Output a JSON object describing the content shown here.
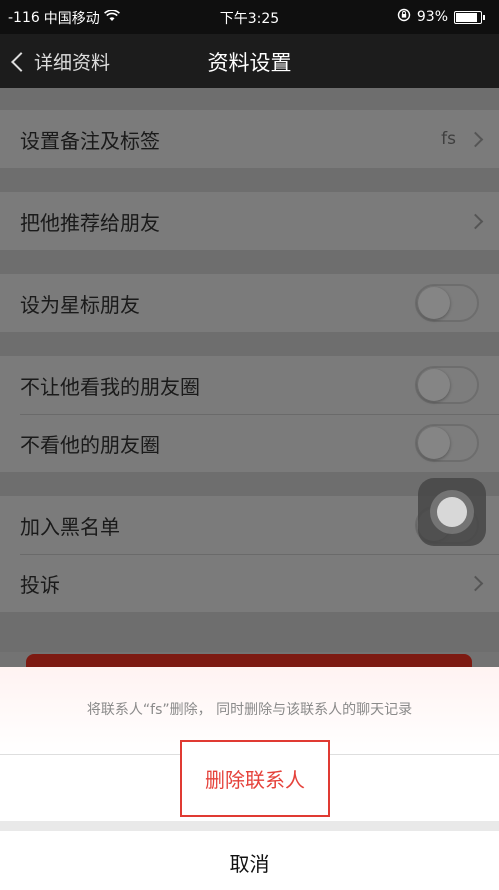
{
  "status_bar": {
    "signal": "-116",
    "carrier": "中国移动",
    "wifi_icon": "wifi-icon",
    "time": "下午3:25",
    "lock_icon": "rotation-lock-icon",
    "battery_percent": "93%",
    "battery_level": 0.93
  },
  "nav": {
    "back_label": "详细资料",
    "title": "资料设置"
  },
  "rows": {
    "remark": {
      "label": "设置备注及标签",
      "value": "fs"
    },
    "recommend": {
      "label": "把他推荐给朋友"
    },
    "star": {
      "label": "设为星标朋友",
      "on": false
    },
    "hide_moments": {
      "label": "不让他看我的朋友圈",
      "on": false
    },
    "block_moments": {
      "label": "不看他的朋友圈",
      "on": false
    },
    "blacklist": {
      "label": "加入黑名单",
      "on": false
    },
    "report": {
      "label": "投诉"
    }
  },
  "action_sheet": {
    "message": "将联系人“fs”删除， 同时删除与该联系人的聊天记录",
    "delete_label": "删除联系人",
    "cancel_label": "取消"
  },
  "colors": {
    "danger": "#e5423b",
    "nav_bg": "#1c1c1c"
  }
}
